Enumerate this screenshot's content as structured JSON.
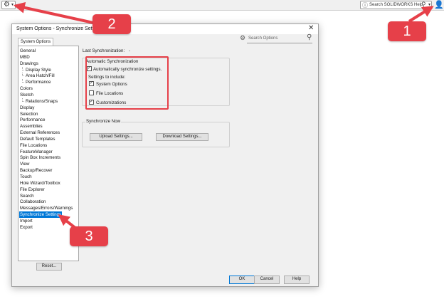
{
  "app": {
    "help_search_placeholder": "Search SOLIDWORKS Help",
    "icons": {
      "gear": "gear-icon",
      "help": "help-icon",
      "search": "magnifier-icon",
      "user": "user-icon"
    }
  },
  "dialog": {
    "title": "System Options - Synchronize Settings",
    "close_glyph": "✕",
    "tab_label": "System Options",
    "search_placeholder": "Search Options",
    "tree_items": [
      {
        "label": "General",
        "indent": 0
      },
      {
        "label": "MBD",
        "indent": 0
      },
      {
        "label": "Drawings",
        "indent": 0
      },
      {
        "label": "Display Style",
        "indent": 1
      },
      {
        "label": "Area Hatch/Fill",
        "indent": 1
      },
      {
        "label": "Performance",
        "indent": 1
      },
      {
        "label": "Colors",
        "indent": 0
      },
      {
        "label": "Sketch",
        "indent": 0
      },
      {
        "label": "Relations/Snaps",
        "indent": 1
      },
      {
        "label": "Display",
        "indent": 0
      },
      {
        "label": "Selection",
        "indent": 0
      },
      {
        "label": "Performance",
        "indent": 0
      },
      {
        "label": "Assemblies",
        "indent": 0
      },
      {
        "label": "External References",
        "indent": 0
      },
      {
        "label": "Default Templates",
        "indent": 0
      },
      {
        "label": "File Locations",
        "indent": 0
      },
      {
        "label": "FeatureManager",
        "indent": 0
      },
      {
        "label": "Spin Box Increments",
        "indent": 0
      },
      {
        "label": "View",
        "indent": 0
      },
      {
        "label": "Backup/Recover",
        "indent": 0
      },
      {
        "label": "Touch",
        "indent": 0
      },
      {
        "label": "Hole Wizard/Toolbox",
        "indent": 0
      },
      {
        "label": "File Explorer",
        "indent": 0
      },
      {
        "label": "Search",
        "indent": 0
      },
      {
        "label": "Collaboration",
        "indent": 0
      },
      {
        "label": "Messages/Errors/Warnings",
        "indent": 0
      },
      {
        "label": "Synchronize Settings",
        "indent": 0,
        "selected": true
      },
      {
        "label": "Import",
        "indent": 0
      },
      {
        "label": "Export",
        "indent": 0
      }
    ],
    "reset_label": "Reset...",
    "last_sync_label": "Last Synchronization:",
    "last_sync_value": "-",
    "auto_sync": {
      "group_label": "Automatic Synchronization",
      "auto_checkbox_label": "Automatically synchronize settings.",
      "auto_checked": true,
      "include_label": "Settings to include:",
      "options": [
        {
          "label": "System Options",
          "checked": true
        },
        {
          "label": "File Locations",
          "checked": false
        },
        {
          "label": "Customizations",
          "checked": true
        }
      ]
    },
    "sync_now": {
      "group_label": "Synchronize Now",
      "upload_label": "Upload Settings...",
      "download_label": "Download Settings..."
    },
    "ok_label": "OK",
    "cancel_label": "Cancel",
    "help_label": "Help"
  },
  "callouts": [
    {
      "number": "1"
    },
    {
      "number": "2"
    },
    {
      "number": "3"
    }
  ],
  "colors": {
    "callout_red": "#e64049",
    "selection_blue": "#0078d7",
    "dialog_bg": "#f0f0f0"
  }
}
